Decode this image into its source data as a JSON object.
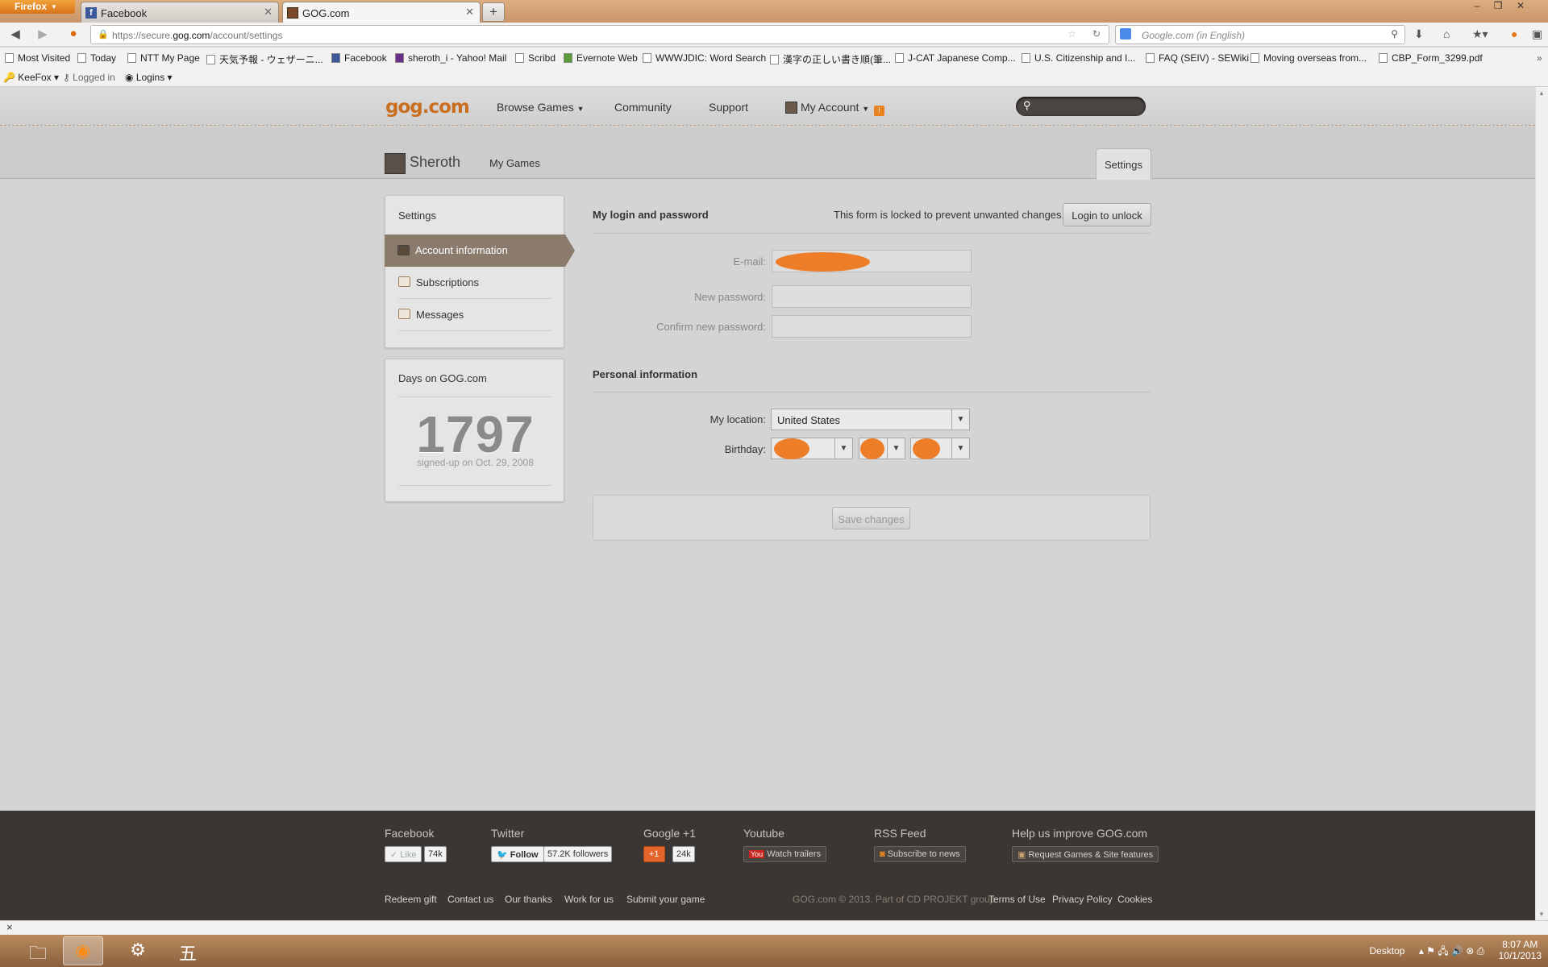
{
  "browser": {
    "menu_button": "Firefox",
    "tabs": [
      {
        "title": "Facebook"
      },
      {
        "title": "GOG.com"
      }
    ],
    "new_tab": "+",
    "url": {
      "prefix": "https://secure.",
      "domain": "gog.com",
      "path": "/account/settings"
    },
    "search_placeholder": "Google.com (in English)",
    "bookmarks": [
      "Most Visited",
      "Today",
      "NTT My Page",
      "天気予報 - ウェザーニ...",
      "Facebook",
      "sheroth_i - Yahoo! Mail",
      "Scribd",
      "Evernote Web",
      "WWWJDIC: Word Search",
      "漢字の正しい書き順(筆...",
      "J-CAT Japanese Comp...",
      "U.S. Citizenship and I...",
      "FAQ (SEIV) - SEWiki",
      "Moving overseas from...",
      "CBP_Form_3299.pdf"
    ],
    "addon_bar": {
      "keefox": "KeeFox",
      "logged_in": "Logged in",
      "logins": "Logins"
    }
  },
  "gog": {
    "logo": "gog.com",
    "nav": {
      "browse": "Browse Games",
      "community": "Community",
      "support": "Support",
      "account": "My Account"
    },
    "user": {
      "name": "Sheroth",
      "my_games": "My Games",
      "settings_tab": "Settings"
    },
    "sidebar": {
      "title": "Settings",
      "items": [
        "Account information",
        "Subscriptions",
        "Messages"
      ]
    },
    "days": {
      "title": "Days on GOG.com",
      "count": "1797",
      "signed_up": "signed-up on Oct. 29, 2008"
    },
    "login_section": {
      "title": "My login and password",
      "lock_message": "This form is locked to prevent unwanted changes.",
      "unlock_button": "Login to unlock",
      "email_label": "E-mail:",
      "new_password_label": "New password:",
      "confirm_password_label": "Confirm new password:"
    },
    "personal_section": {
      "title": "Personal information",
      "location_label": "My location:",
      "location_value": "United States",
      "birthday_label": "Birthday:"
    },
    "save_button": "Save changes",
    "footer": {
      "facebook": {
        "title": "Facebook",
        "button": "Like",
        "count": "74k"
      },
      "twitter": {
        "title": "Twitter",
        "button": "Follow",
        "count": "57.2K followers"
      },
      "google": {
        "title": "Google +1",
        "button": "+1",
        "count": "24k"
      },
      "youtube": {
        "title": "Youtube",
        "button": "Watch trailers"
      },
      "rss": {
        "title": "RSS Feed",
        "button": "Subscribe to news"
      },
      "improve": {
        "title": "Help us improve GOG.com",
        "button": "Request Games & Site features"
      },
      "links": [
        "Redeem gift",
        "Contact us",
        "Our thanks",
        "Work for us",
        "Submit your game"
      ],
      "copyright": "GOG.com © 2013. Part of CD PROJEKT group",
      "legal": [
        "Terms of Use",
        "Privacy Policy",
        "Cookies"
      ]
    }
  },
  "taskbar": {
    "desktop": "Desktop",
    "time": "8:07 AM",
    "date": "10/1/2013"
  },
  "colors": {
    "accent": "#ee7d28",
    "footer_bg": "#3a3633",
    "active_item": "#8a7b6c"
  }
}
